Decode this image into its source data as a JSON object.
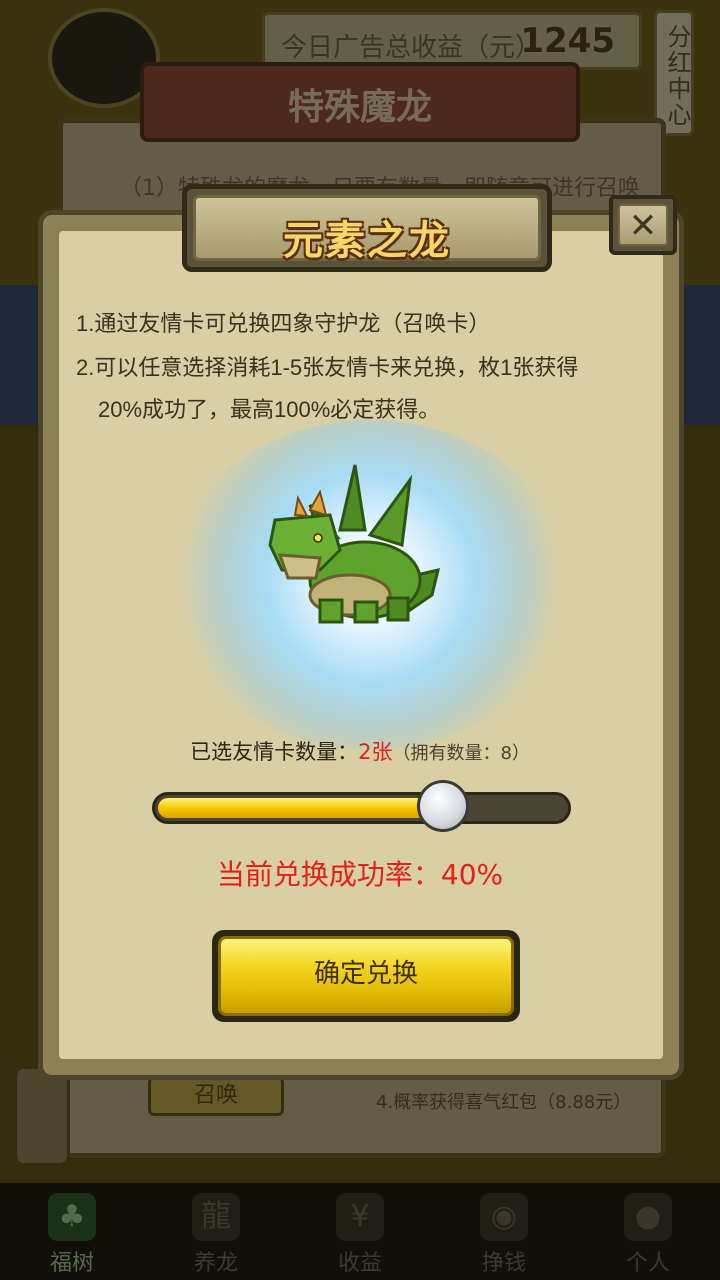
{
  "background": {
    "earnings_label": "今日广告总收益（元）",
    "earnings_value": "1245",
    "fenhong_label": "分红中心",
    "back_panel_title": "特殊魔龙",
    "back_panel_line": "（1）特殊龙的魔龙，只要有数量，即随意可进行召唤",
    "summon_label": "召唤",
    "prob_text": "4.概率获得喜气红包（8.88元）"
  },
  "bottom_nav": [
    {
      "label": "福树",
      "icon": "tree-icon",
      "glyph": "♣"
    },
    {
      "label": "养龙",
      "icon": "dragon-icon",
      "glyph": "龍"
    },
    {
      "label": "收益",
      "icon": "money-bag-icon",
      "glyph": "¥"
    },
    {
      "label": "挣钱",
      "icon": "coin-icon",
      "glyph": "◉"
    },
    {
      "label": "个人",
      "icon": "person-icon",
      "glyph": "●"
    }
  ],
  "modal": {
    "title": "元素之龙",
    "close_icon": "close-icon",
    "close_glyph": "✕",
    "rule1": "1.通过友情卡可兑换四象守护龙（召唤卡）",
    "rule2": "2.可以任意选择消耗1-5张友情卡来兑换，枚1张获得",
    "rule2_cont": "20%成功了，最高100%必定获得。",
    "dragon_image": "green-dragon-image",
    "selected_label": "已选友情卡数量：",
    "selected_count": "2张",
    "owned_text": "（拥有数量：8）",
    "slider_level": 0.66,
    "rate_label": "当前兑换成功率：40%",
    "confirm_label": "确定兑换"
  },
  "colors": {
    "accent_red": "#e0201a",
    "button_yellow": "#f3d21c",
    "panel_beige": "#d9cfa4"
  }
}
